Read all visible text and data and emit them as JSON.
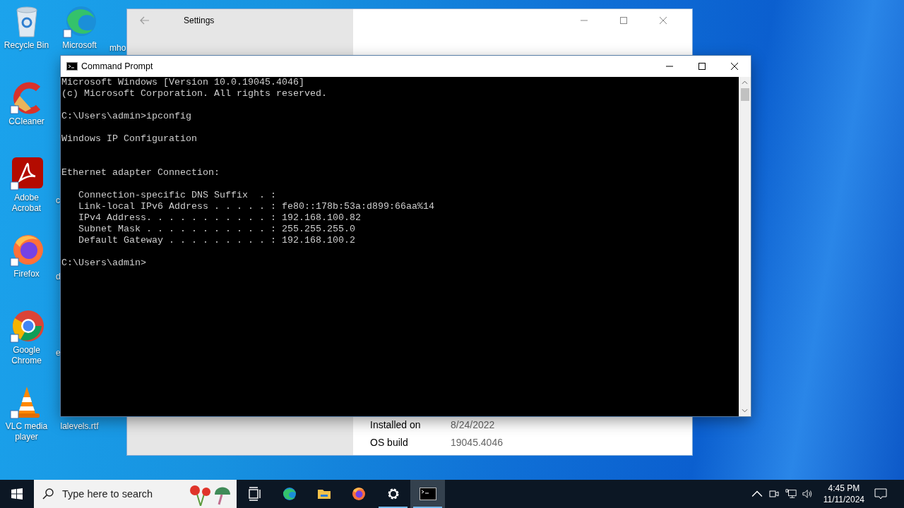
{
  "desktop": {
    "columns": [
      [
        {
          "kind": "recycle",
          "label": "Recycle Bin"
        },
        {
          "kind": "ccleaner",
          "label": "CCleaner"
        },
        {
          "kind": "acrobat",
          "label": "Adobe Acrobat"
        },
        {
          "kind": "firefox",
          "label": "Firefox"
        },
        {
          "kind": "chrome",
          "label": "Google Chrome"
        },
        {
          "kind": "vlc",
          "label": "VLC media player"
        }
      ],
      [
        {
          "kind": "edge",
          "label": "Microsoft"
        },
        {
          "kind": "hidden",
          "label": "c"
        },
        {
          "kind": "hidden",
          "label": "d"
        },
        {
          "kind": "hidden",
          "label": "e"
        },
        {
          "kind": "covered",
          "label": "lalevels.rtf"
        }
      ],
      [
        {
          "kind": "hidden",
          "label": "mho"
        }
      ]
    ]
  },
  "settings_window": {
    "title": "Settings",
    "rows": [
      {
        "label": "Installed on",
        "value": "8/24/2022"
      },
      {
        "label": "OS build",
        "value": "19045.4046"
      }
    ]
  },
  "cmd_window": {
    "title": "Command Prompt",
    "blocks": [
      [
        "Microsoft Windows [Version 10.0.19045.4046]",
        "(c) Microsoft Corporation. All rights reserved."
      ],
      [
        "C:\\Users\\admin>ipconfig"
      ],
      [
        "Windows IP Configuration"
      ],
      [
        "Ethernet adapter Connection:"
      ],
      [
        "   Connection-specific DNS Suffix  . :",
        "   Link-local IPv6 Address . . . . . : fe80::178b:53a:d899:66aa%14",
        "   IPv4 Address. . . . . . . . . . . : 192.168.100.82",
        "   Subnet Mask . . . . . . . . . . . : 255.255.255.0",
        "   Default Gateway . . . . . . . . . : 192.168.100.2"
      ],
      [
        "C:\\Users\\admin>"
      ]
    ]
  },
  "taskbar": {
    "search": {
      "placeholder": "Type here to search"
    },
    "apps": [
      {
        "kind": "taskview",
        "running": false,
        "selected": false
      },
      {
        "kind": "edge",
        "running": false,
        "selected": false
      },
      {
        "kind": "explorer",
        "running": false,
        "selected": false
      },
      {
        "kind": "firefox",
        "running": false,
        "selected": false
      },
      {
        "kind": "settings",
        "running": true,
        "selected": false
      },
      {
        "kind": "cmd",
        "running": true,
        "selected": true
      }
    ],
    "clock": {
      "time": "4:45 PM",
      "date": "11/11/2024"
    }
  }
}
